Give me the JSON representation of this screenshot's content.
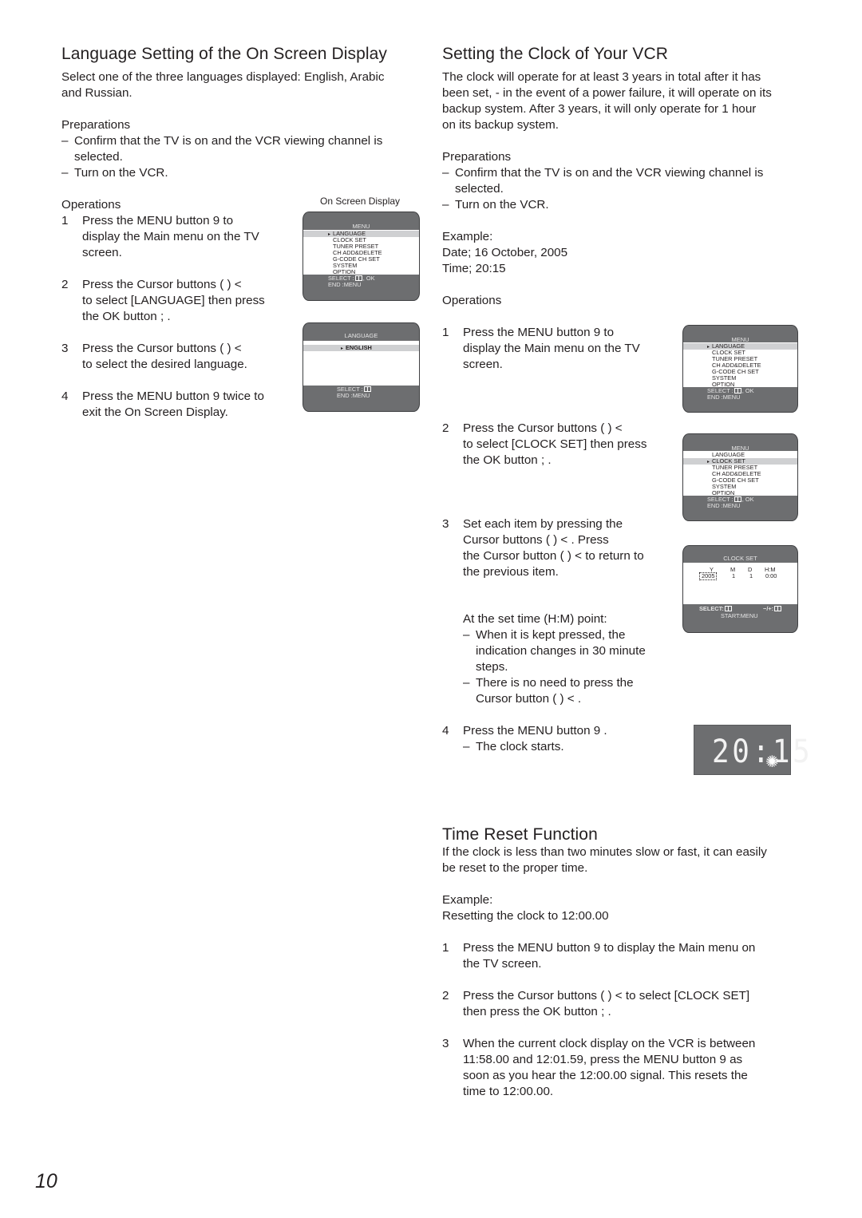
{
  "page_number": "10",
  "left": {
    "title": "Language Setting of the On Screen Display",
    "intro": [
      "Select one of the three languages displayed: English, Arabic",
      "and Russian."
    ],
    "preparations_label": "Preparations",
    "preparations": [
      {
        "dash": "–",
        "lines": [
          "Confirm that the TV is on and the VCR viewing channel is",
          "selected."
        ]
      },
      {
        "dash": "–",
        "lines": [
          "Turn on the VCR."
        ]
      }
    ],
    "operations_label": "Operations",
    "osd_caption": "On Screen Display",
    "steps": [
      {
        "num": "1",
        "lines": [
          "Press the MENU button 9   to",
          "display the Main menu on the TV",
          "screen."
        ]
      },
      {
        "num": "2",
        "lines": [
          "Press the Cursor buttons (        ) <",
          "to select [LANGUAGE] then press",
          "the OK button ;   ."
        ]
      },
      {
        "num": "3",
        "lines": [
          "Press the Cursor buttons (        ) <",
          "to select the desired language."
        ]
      },
      {
        "num": "4",
        "lines": [
          "Press the MENU button 9   twice to",
          "exit the On Screen Display."
        ]
      }
    ]
  },
  "right": {
    "title": "Setting the Clock of Your VCR",
    "intro": [
      "The clock will operate for at least 3 years in total after it has",
      "been set, - in the event of a power failure, it will operate on its",
      "backup system. After 3 years, it will only operate for 1 hour",
      "on its backup system."
    ],
    "preparations_label": "Preparations",
    "preparations": [
      {
        "dash": "–",
        "lines": [
          "Confirm that the TV is on and the VCR viewing channel is",
          "selected."
        ]
      },
      {
        "dash": "–",
        "lines": [
          "Turn on the VCR."
        ]
      }
    ],
    "example_label": "Example:",
    "example_date": "Date;   16 October, 2005",
    "example_time": "Time;   20:15",
    "operations_label": "Operations",
    "steps": [
      {
        "num": "1",
        "lines": [
          "Press the MENU button 9   to",
          "display the Main menu on the TV",
          "screen."
        ]
      },
      {
        "num": "2",
        "lines": [
          "Press the Cursor buttons (        ) <",
          "to select [CLOCK SET] then press",
          "the OK button ;   ."
        ]
      },
      {
        "num": "3",
        "lines": [
          "Set each item by pressing the",
          "Cursor buttons (             ) <  . Press",
          "the Cursor button (    ) <   to return to",
          "the previous item."
        ]
      },
      {
        "num": "4",
        "lines": [
          "Press the MENU button 9  ."
        ]
      }
    ],
    "hm_note_label": "At the set time (H:M) point:",
    "hm_notes": [
      {
        "dash": "–",
        "lines": [
          "When it is kept pressed, the",
          "indication changes in 30 minute",
          "steps."
        ]
      },
      {
        "dash": "–",
        "lines": [
          "There is no need to press the",
          "Cursor button (    ) <  ."
        ]
      }
    ],
    "step4_note": {
      "dash": "–",
      "text": "The clock starts."
    },
    "clock_display": "20:15"
  },
  "reset": {
    "title": "Time Reset Function",
    "intro": [
      "If the clock is less than two minutes slow or fast, it can easily",
      "be reset to the proper time."
    ],
    "example_label": "Example:",
    "example_text": "Resetting the clock to 12:00.00",
    "steps": [
      {
        "num": "1",
        "lines": [
          "Press the MENU button 9   to display the Main menu on",
          "the TV screen."
        ]
      },
      {
        "num": "2",
        "lines": [
          "Press the Cursor buttons (        ) <   to select [CLOCK SET]",
          "then press the OK button ;   ."
        ]
      },
      {
        "num": "3",
        "lines": [
          "When the current clock display on the VCR is between",
          "11:58.00 and 12:01.59, press the MENU button 9   as",
          "soon as you hear the 12:00.00 signal. This resets the",
          "time to 12:00.00."
        ]
      }
    ]
  },
  "screens": {
    "main_menu": {
      "title": "MENU",
      "items": [
        "LANGUAGE",
        "CLOCK SET",
        "TUNER PRESET",
        "CH ADD&DELETE",
        "G-CODE CH SET",
        "SYSTEM",
        "OPTION"
      ],
      "footer_select": "SELECT :",
      "footer_select_suffix": ", OK",
      "footer_end": "END      :MENU"
    },
    "language_menu": {
      "title": "LANGUAGE",
      "selected": "ENGLISH",
      "footer_select": "SELECT :",
      "footer_end": "END      :MENU"
    },
    "clock_set": {
      "title": "CLOCK SET",
      "headers": [
        "Y",
        "M",
        "D",
        "H:M"
      ],
      "values": [
        "2005",
        "1",
        "1",
        "0:00"
      ],
      "footer_select": "SELECT:",
      "footer_adjust": "−/+:",
      "footer_start": "START:MENU"
    }
  },
  "colors": {
    "screen_gray": "#6d6e70",
    "highlight": "#cfd0d2",
    "text": "#231f20"
  }
}
